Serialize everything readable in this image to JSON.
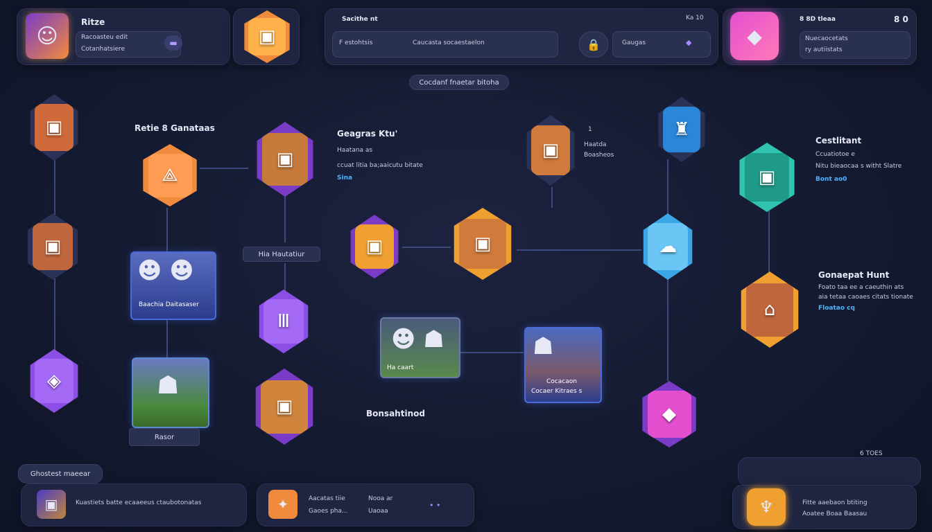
{
  "top": {
    "profile": {
      "name": "Ritze",
      "line1": "Racoasteu edit",
      "line2": "Cotanhatsiere"
    },
    "search": {
      "title": "Sacithe nt",
      "label": "F estohtsis",
      "placeholder": "Caucasta socaestaelon",
      "tab": "Gaugas",
      "counter": "Ka 10"
    },
    "right": {
      "title": "8 8D tleaa",
      "counter": "8 0",
      "line1": "Nuecaocetats",
      "line2": "ry autiistats"
    }
  },
  "center_tag": "Cocdanf fnaetar bitoha",
  "nodes": {
    "label_left": "Retie 8 Ganataas",
    "group1": {
      "title": "Geagras Ktu'",
      "line1": "Haatana as",
      "line2": "ccuat litia ba;aaicutu bitate",
      "link": "Sina"
    },
    "group2": {
      "line1": "1",
      "line2": "Haatda",
      "line3": "Boasheos"
    },
    "group3": {
      "title": "Cestlitant",
      "line1": "Ccuatiotoe e",
      "line2": "Nitu bieaocaa s witht Slatre",
      "link": "Bont ao0"
    },
    "group4": {
      "title": "Gonaepat Hunt",
      "line1": "Foato taa ee a caeuthin ats",
      "line2": "aia tetaa caoaes citats tionate",
      "link": "Floatao cq"
    },
    "mid_pill": "Hia Hautatiur",
    "card1": "Baachia Daitasaser",
    "card2": "Rasor",
    "card3": "Cocacaon",
    "card3b": "Cocaer  Kitraes s",
    "card4": "Ha caart",
    "bottom_label": "Bonsahtinod"
  },
  "bottom": {
    "tag": "Ghostest maeear",
    "left": {
      "text": "Kuastiets batte ecaaeeus ctaubotonatas"
    },
    "mid": {
      "line1": "Aacatas tiie",
      "line2": "Gaoes pha...",
      "line3": "Nooa  ar",
      "line4": "Uaoaa"
    },
    "right": {
      "line1": "Fitte aaebaon btiting",
      "line2": "Aoatee Boaa Baasau",
      "counter": "6 TOES"
    }
  },
  "colors": {
    "accent": "#4fb4ff",
    "orange": "#f08a3c",
    "purple": "#8c4fe6",
    "teal": "#2fc3b0",
    "pink": "#e44fd0",
    "blue": "#3aa6e6"
  },
  "icons": [
    "profile-avatar-icon",
    "treasure-chest-icon",
    "crystal-gem-icon",
    "search-icon",
    "settings-icon"
  ]
}
